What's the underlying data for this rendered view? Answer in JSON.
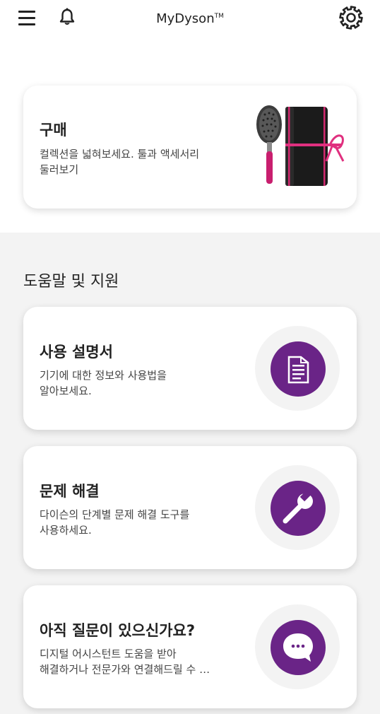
{
  "header": {
    "title": "MyDyson",
    "title_mark": "TM",
    "menu_icon": "hamburger-menu-icon",
    "notification_icon": "bell-icon",
    "settings_icon": "gear-icon"
  },
  "shop_card": {
    "title": "구매",
    "description": "컬렉션을 넓혀보세요. 툴과 액세서리\n둘러보기",
    "image": "brush-and-pouch-product-image"
  },
  "help_section": {
    "heading": "도움말 및 지원",
    "cards": [
      {
        "title": "사용 설명서",
        "description": "기기에 대한 정보와 사용법을\n알아보세요.",
        "icon": "document-icon"
      },
      {
        "title": "문제 해결",
        "description": "다이슨의 단계별 문제 해결 도구를\n사용하세요.",
        "icon": "wrench-icon"
      },
      {
        "title": "아직 질문이 있으신가요?",
        "description": "디지털 어시스턴트 도움을 받아\n해결하거나 전문가와 연결해드릴 수 …",
        "icon": "chat-bubble-icon"
      }
    ]
  },
  "colors": {
    "accent": "#6a2487",
    "icon_background": "#f3f3f3",
    "section_background": "#f3f3f3",
    "brush_handle": "#c81e6e",
    "pouch": "#1b1b1b",
    "ribbon": "#e0307f"
  }
}
